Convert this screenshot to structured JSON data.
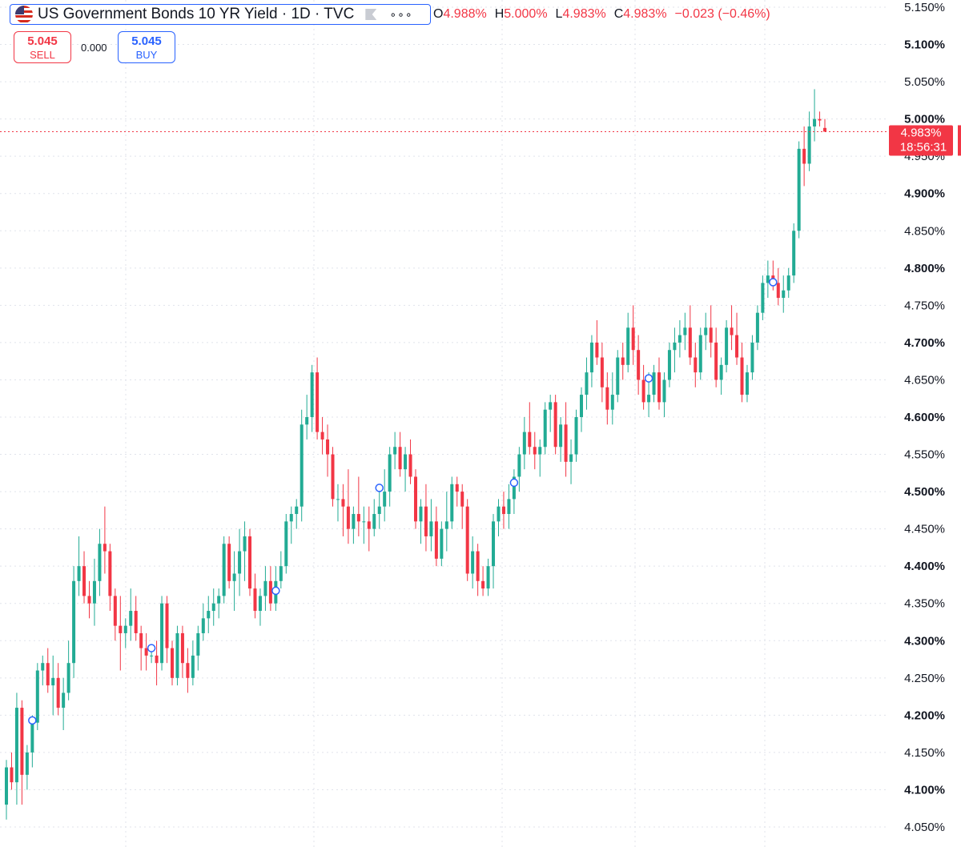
{
  "header": {
    "title": "US Government Bonds 10 YR Yield · 1D · TVC",
    "ohlc": {
      "o_label": "O",
      "o_value": "4.988%",
      "h_label": "H",
      "h_value": "5.000%",
      "l_label": "L",
      "l_value": "4.983%",
      "c_label": "C",
      "c_value": "4.983%",
      "change": "−0.023 (−0.46%)"
    }
  },
  "trade": {
    "sell_price": "5.045",
    "sell_label": "SELL",
    "spread": "0.000",
    "buy_price": "5.045",
    "buy_label": "BUY"
  },
  "price_tag": {
    "price": "4.983%",
    "countdown": "18:56:31",
    "value": 4.983
  },
  "colors": {
    "up": "#22ab94",
    "down": "#f23645",
    "accent": "#2962ff",
    "grid": "#e0e3eb"
  },
  "chart_data": {
    "type": "candlestick",
    "title": "US Government Bonds 10 YR Yield · 1D · TVC",
    "ylim": [
      4.03,
      5.16
    ],
    "yticks": [
      {
        "value": 5.15,
        "label": "5.150%",
        "bold": false
      },
      {
        "value": 5.1,
        "label": "5.100%",
        "bold": true
      },
      {
        "value": 5.05,
        "label": "5.050%",
        "bold": false
      },
      {
        "value": 5.0,
        "label": "5.000%",
        "bold": true
      },
      {
        "value": 4.95,
        "label": "4.950%",
        "bold": false
      },
      {
        "value": 4.9,
        "label": "4.900%",
        "bold": true
      },
      {
        "value": 4.85,
        "label": "4.850%",
        "bold": false
      },
      {
        "value": 4.8,
        "label": "4.800%",
        "bold": true
      },
      {
        "value": 4.75,
        "label": "4.750%",
        "bold": false
      },
      {
        "value": 4.7,
        "label": "4.700%",
        "bold": true
      },
      {
        "value": 4.65,
        "label": "4.650%",
        "bold": false
      },
      {
        "value": 4.6,
        "label": "4.600%",
        "bold": true
      },
      {
        "value": 4.55,
        "label": "4.550%",
        "bold": false
      },
      {
        "value": 4.5,
        "label": "4.500%",
        "bold": true
      },
      {
        "value": 4.45,
        "label": "4.450%",
        "bold": false
      },
      {
        "value": 4.4,
        "label": "4.400%",
        "bold": true
      },
      {
        "value": 4.35,
        "label": "4.350%",
        "bold": false
      },
      {
        "value": 4.3,
        "label": "4.300%",
        "bold": true
      },
      {
        "value": 4.25,
        "label": "4.250%",
        "bold": false
      },
      {
        "value": 4.2,
        "label": "4.200%",
        "bold": true
      },
      {
        "value": 4.15,
        "label": "4.150%",
        "bold": false
      },
      {
        "value": 4.1,
        "label": "4.100%",
        "bold": true
      },
      {
        "value": 4.05,
        "label": "4.050%",
        "bold": false
      }
    ],
    "candles": [
      [
        4.08,
        4.14,
        4.06,
        4.13
      ],
      [
        4.13,
        4.15,
        4.1,
        4.11
      ],
      [
        4.11,
        4.23,
        4.08,
        4.21
      ],
      [
        4.21,
        4.22,
        4.08,
        4.12
      ],
      [
        4.12,
        4.16,
        4.1,
        4.15
      ],
      [
        4.15,
        4.2,
        4.13,
        4.19
      ],
      [
        4.19,
        4.27,
        4.18,
        4.26
      ],
      [
        4.26,
        4.28,
        4.24,
        4.27
      ],
      [
        4.27,
        4.29,
        4.23,
        4.24
      ],
      [
        4.24,
        4.28,
        4.2,
        4.25
      ],
      [
        4.25,
        4.27,
        4.2,
        4.21
      ],
      [
        4.21,
        4.25,
        4.18,
        4.23
      ],
      [
        4.23,
        4.3,
        4.22,
        4.27
      ],
      [
        4.27,
        4.4,
        4.25,
        4.38
      ],
      [
        4.38,
        4.44,
        4.36,
        4.4
      ],
      [
        4.4,
        4.42,
        4.35,
        4.36
      ],
      [
        4.36,
        4.38,
        4.33,
        4.35
      ],
      [
        4.35,
        4.41,
        4.32,
        4.38
      ],
      [
        4.38,
        4.45,
        4.36,
        4.43
      ],
      [
        4.43,
        4.48,
        4.39,
        4.42
      ],
      [
        4.42,
        4.43,
        4.34,
        4.36
      ],
      [
        4.36,
        4.37,
        4.3,
        4.32
      ],
      [
        4.32,
        4.36,
        4.26,
        4.31
      ],
      [
        4.31,
        4.33,
        4.29,
        4.32
      ],
      [
        4.32,
        4.37,
        4.3,
        4.34
      ],
      [
        4.34,
        4.36,
        4.3,
        4.31
      ],
      [
        4.31,
        4.32,
        4.26,
        4.29
      ],
      [
        4.29,
        4.31,
        4.26,
        4.28
      ],
      [
        4.28,
        4.29,
        4.27,
        4.28
      ],
      [
        4.28,
        4.3,
        4.24,
        4.27
      ],
      [
        4.27,
        4.36,
        4.26,
        4.35
      ],
      [
        4.35,
        4.36,
        4.27,
        4.29
      ],
      [
        4.29,
        4.3,
        4.24,
        4.25
      ],
      [
        4.25,
        4.32,
        4.24,
        4.31
      ],
      [
        4.31,
        4.32,
        4.25,
        4.27
      ],
      [
        4.27,
        4.29,
        4.23,
        4.25
      ],
      [
        4.25,
        4.3,
        4.24,
        4.28
      ],
      [
        4.28,
        4.32,
        4.26,
        4.31
      ],
      [
        4.31,
        4.35,
        4.3,
        4.33
      ],
      [
        4.33,
        4.36,
        4.31,
        4.34
      ],
      [
        4.34,
        4.37,
        4.32,
        4.35
      ],
      [
        4.35,
        4.37,
        4.33,
        4.36
      ],
      [
        4.36,
        4.44,
        4.35,
        4.43
      ],
      [
        4.43,
        4.44,
        4.37,
        4.38
      ],
      [
        4.38,
        4.42,
        4.34,
        4.39
      ],
      [
        4.39,
        4.45,
        4.36,
        4.42
      ],
      [
        4.42,
        4.46,
        4.38,
        4.44
      ],
      [
        4.44,
        4.45,
        4.36,
        4.37
      ],
      [
        4.37,
        4.39,
        4.33,
        4.34
      ],
      [
        4.34,
        4.37,
        4.32,
        4.36
      ],
      [
        4.36,
        4.4,
        4.34,
        4.38
      ],
      [
        4.38,
        4.4,
        4.34,
        4.35
      ],
      [
        4.35,
        4.4,
        4.34,
        4.38
      ],
      [
        4.38,
        4.42,
        4.37,
        4.4
      ],
      [
        4.4,
        4.47,
        4.39,
        4.46
      ],
      [
        4.46,
        4.48,
        4.43,
        4.47
      ],
      [
        4.47,
        4.49,
        4.45,
        4.48
      ],
      [
        4.48,
        4.61,
        4.46,
        4.59
      ],
      [
        4.59,
        4.63,
        4.57,
        4.6
      ],
      [
        4.6,
        4.67,
        4.58,
        4.66
      ],
      [
        4.66,
        4.68,
        4.57,
        4.58
      ],
      [
        4.58,
        4.6,
        4.55,
        4.57
      ],
      [
        4.57,
        4.59,
        4.52,
        4.55
      ],
      [
        4.55,
        4.56,
        4.48,
        4.49
      ],
      [
        4.49,
        4.51,
        4.46,
        4.49
      ],
      [
        4.49,
        4.51,
        4.44,
        4.48
      ],
      [
        4.48,
        4.53,
        4.43,
        4.45
      ],
      [
        4.45,
        4.48,
        4.43,
        4.47
      ],
      [
        4.47,
        4.52,
        4.44,
        4.46
      ],
      [
        4.46,
        4.48,
        4.43,
        4.46
      ],
      [
        4.46,
        4.48,
        4.42,
        4.45
      ],
      [
        4.45,
        4.49,
        4.44,
        4.47
      ],
      [
        4.47,
        4.51,
        4.45,
        4.48
      ],
      [
        4.48,
        4.53,
        4.46,
        4.5
      ],
      [
        4.5,
        4.56,
        4.48,
        4.55
      ],
      [
        4.55,
        4.58,
        4.53,
        4.56
      ],
      [
        4.56,
        4.58,
        4.52,
        4.53
      ],
      [
        4.53,
        4.56,
        4.5,
        4.55
      ],
      [
        4.55,
        4.57,
        4.51,
        4.52
      ],
      [
        4.52,
        4.53,
        4.45,
        4.46
      ],
      [
        4.46,
        4.49,
        4.43,
        4.48
      ],
      [
        4.48,
        4.51,
        4.42,
        4.44
      ],
      [
        4.44,
        4.49,
        4.42,
        4.46
      ],
      [
        4.46,
        4.48,
        4.4,
        4.41
      ],
      [
        4.41,
        4.46,
        4.4,
        4.45
      ],
      [
        4.45,
        4.5,
        4.42,
        4.46
      ],
      [
        4.46,
        4.52,
        4.45,
        4.51
      ],
      [
        4.51,
        4.52,
        4.48,
        4.5
      ],
      [
        4.5,
        4.51,
        4.45,
        4.48
      ],
      [
        4.48,
        4.49,
        4.38,
        4.39
      ],
      [
        4.39,
        4.44,
        4.37,
        4.42
      ],
      [
        4.42,
        4.43,
        4.36,
        4.38
      ],
      [
        4.38,
        4.4,
        4.36,
        4.37
      ],
      [
        4.37,
        4.41,
        4.36,
        4.4
      ],
      [
        4.4,
        4.47,
        4.37,
        4.46
      ],
      [
        4.46,
        4.49,
        4.44,
        4.48
      ],
      [
        4.48,
        4.5,
        4.45,
        4.47
      ],
      [
        4.47,
        4.51,
        4.45,
        4.49
      ],
      [
        4.49,
        4.53,
        4.47,
        4.52
      ],
      [
        4.52,
        4.56,
        4.5,
        4.55
      ],
      [
        4.55,
        4.6,
        4.53,
        4.58
      ],
      [
        4.58,
        4.62,
        4.55,
        4.56
      ],
      [
        4.56,
        4.58,
        4.53,
        4.55
      ],
      [
        4.55,
        4.57,
        4.52,
        4.56
      ],
      [
        4.56,
        4.62,
        4.55,
        4.61
      ],
      [
        4.61,
        4.63,
        4.58,
        4.62
      ],
      [
        4.62,
        4.63,
        4.55,
        4.56
      ],
      [
        4.56,
        4.6,
        4.54,
        4.59
      ],
      [
        4.59,
        4.62,
        4.52,
        4.54
      ],
      [
        4.54,
        4.57,
        4.51,
        4.55
      ],
      [
        4.55,
        4.61,
        4.54,
        4.6
      ],
      [
        4.6,
        4.64,
        4.58,
        4.63
      ],
      [
        4.63,
        4.68,
        4.61,
        4.66
      ],
      [
        4.66,
        4.71,
        4.64,
        4.7
      ],
      [
        4.7,
        4.73,
        4.67,
        4.68
      ],
      [
        4.68,
        4.7,
        4.62,
        4.64
      ],
      [
        4.64,
        4.66,
        4.59,
        4.61
      ],
      [
        4.61,
        4.66,
        4.59,
        4.63
      ],
      [
        4.63,
        4.69,
        4.62,
        4.68
      ],
      [
        4.68,
        4.7,
        4.65,
        4.67
      ],
      [
        4.67,
        4.74,
        4.66,
        4.72
      ],
      [
        4.72,
        4.75,
        4.67,
        4.69
      ],
      [
        4.69,
        4.71,
        4.63,
        4.65
      ],
      [
        4.65,
        4.67,
        4.61,
        4.62
      ],
      [
        4.62,
        4.66,
        4.6,
        4.63
      ],
      [
        4.63,
        4.67,
        4.62,
        4.66
      ],
      [
        4.66,
        4.68,
        4.61,
        4.62
      ],
      [
        4.62,
        4.66,
        4.6,
        4.65
      ],
      [
        4.65,
        4.7,
        4.64,
        4.69
      ],
      [
        4.69,
        4.72,
        4.66,
        4.7
      ],
      [
        4.7,
        4.73,
        4.68,
        4.71
      ],
      [
        4.71,
        4.74,
        4.69,
        4.72
      ],
      [
        4.72,
        4.75,
        4.67,
        4.68
      ],
      [
        4.68,
        4.7,
        4.64,
        4.66
      ],
      [
        4.66,
        4.72,
        4.65,
        4.71
      ],
      [
        4.71,
        4.74,
        4.69,
        4.72
      ],
      [
        4.72,
        4.75,
        4.68,
        4.7
      ],
      [
        4.7,
        4.72,
        4.64,
        4.65
      ],
      [
        4.65,
        4.68,
        4.63,
        4.67
      ],
      [
        4.67,
        4.73,
        4.66,
        4.72
      ],
      [
        4.72,
        4.75,
        4.69,
        4.71
      ],
      [
        4.71,
        4.74,
        4.67,
        4.68
      ],
      [
        4.68,
        4.7,
        4.62,
        4.63
      ],
      [
        4.63,
        4.67,
        4.62,
        4.66
      ],
      [
        4.66,
        4.71,
        4.65,
        4.7
      ],
      [
        4.7,
        4.75,
        4.69,
        4.74
      ],
      [
        4.74,
        4.79,
        4.73,
        4.78
      ],
      [
        4.78,
        4.81,
        4.76,
        4.79
      ],
      [
        4.79,
        4.81,
        4.77,
        4.78
      ],
      [
        4.78,
        4.8,
        4.75,
        4.76
      ],
      [
        4.76,
        4.79,
        4.74,
        4.77
      ],
      [
        4.77,
        4.8,
        4.76,
        4.79
      ],
      [
        4.79,
        4.86,
        4.78,
        4.85
      ],
      [
        4.85,
        4.97,
        4.84,
        4.96
      ],
      [
        4.96,
        4.99,
        4.91,
        4.94
      ],
      [
        4.94,
        5.01,
        4.93,
        4.99
      ],
      [
        4.99,
        5.04,
        4.97,
        5.0
      ],
      [
        5.0,
        5.01,
        4.99,
        4.998
      ],
      [
        4.988,
        5.0,
        4.983,
        4.983
      ]
    ],
    "markers": [
      {
        "index": 5,
        "value": 4.193
      },
      {
        "index": 28,
        "value": 4.29
      },
      {
        "index": 52,
        "value": 4.367
      },
      {
        "index": 72,
        "value": 4.505
      },
      {
        "index": 98,
        "value": 4.512
      },
      {
        "index": 124,
        "value": 4.652
      },
      {
        "index": 148,
        "value": 4.781
      }
    ]
  }
}
